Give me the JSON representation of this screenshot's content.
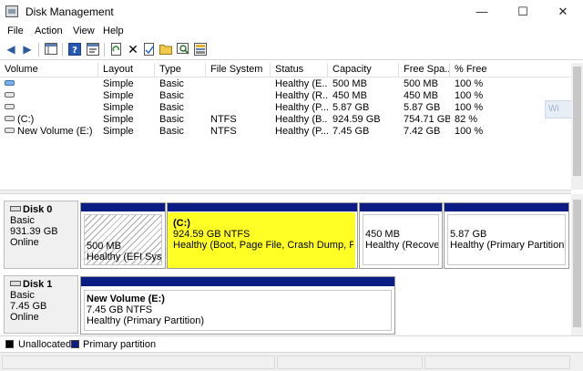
{
  "window": {
    "title": "Disk Management",
    "minimize": "—",
    "maximize": "☐",
    "close": "✕"
  },
  "menu": [
    "File",
    "Action",
    "View",
    "Help"
  ],
  "toolbar_icons": [
    "back-arrow-icon",
    "forward-arrow-icon",
    "console-tree-icon",
    "help-icon",
    "properties-icon",
    "refresh-icon",
    "delete-icon",
    "open-folder-icon",
    "search-icon",
    "settings-icon"
  ],
  "volume_list": {
    "columns": [
      "Volume",
      "Layout",
      "Type",
      "File System",
      "Status",
      "Capacity",
      "Free Spa...",
      "% Free"
    ],
    "rows": [
      {
        "volume": "",
        "layout": "Simple",
        "type": "Basic",
        "fs": "",
        "status": "Healthy (E...",
        "capacity": "500 MB",
        "free": "500 MB",
        "pct": "100 %"
      },
      {
        "volume": "",
        "layout": "Simple",
        "type": "Basic",
        "fs": "",
        "status": "Healthy (R...",
        "capacity": "450 MB",
        "free": "450 MB",
        "pct": "100 %"
      },
      {
        "volume": "",
        "layout": "Simple",
        "type": "Basic",
        "fs": "",
        "status": "Healthy (P...",
        "capacity": "5.87 GB",
        "free": "5.87 GB",
        "pct": "100 %"
      },
      {
        "volume": "(C:)",
        "layout": "Simple",
        "type": "Basic",
        "fs": "NTFS",
        "status": "Healthy (B...",
        "capacity": "924.59 GB",
        "free": "754.71 GB",
        "pct": "82 %"
      },
      {
        "volume": "New Volume (E:)",
        "layout": "Simple",
        "type": "Basic",
        "fs": "NTFS",
        "status": "Healthy (P...",
        "capacity": "7.45 GB",
        "free": "7.42 GB",
        "pct": "100 %"
      }
    ]
  },
  "ghost_text": "Wi",
  "disks": [
    {
      "name": "Disk 0",
      "type": "Basic",
      "size": "931.39 GB",
      "state": "Online",
      "partitions": [
        {
          "title": "",
          "size": "500 MB",
          "status": "Healthy (EFI System"
        },
        {
          "title": "(C:)",
          "size": "924.59 GB NTFS",
          "status": "Healthy (Boot, Page File, Crash Dump, Primar"
        },
        {
          "title": "",
          "size": "450 MB",
          "status": "Healthy (Recovery"
        },
        {
          "title": "",
          "size": "5.87 GB",
          "status": "Healthy (Primary Partition)"
        }
      ]
    },
    {
      "name": "Disk 1",
      "type": "Basic",
      "size": "7.45 GB",
      "state": "Online",
      "partitions": [
        {
          "title": "New Volume  (E:)",
          "size": "7.45 GB NTFS",
          "status": "Healthy (Primary Partition)"
        }
      ]
    }
  ],
  "legend": [
    {
      "label": "Unallocated",
      "color": "#000000"
    },
    {
      "label": "Primary partition",
      "color": "#0b1d84"
    }
  ],
  "colors": {
    "partition_bar": "#0b1d84",
    "highlight": "#ffff00"
  }
}
